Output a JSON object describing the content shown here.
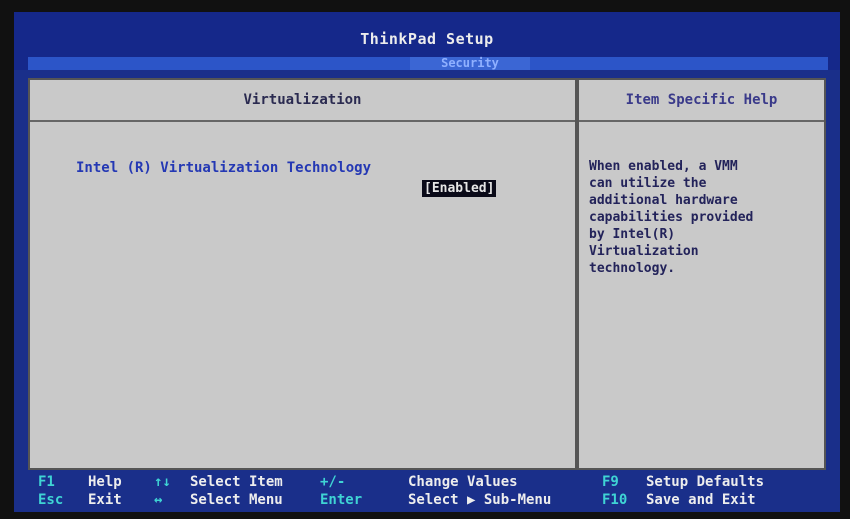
{
  "title": "ThinkPad Setup",
  "active_tab": "Security",
  "main_panel": {
    "header": "Virtualization",
    "items": [
      {
        "label": "Intel (R) Virtualization Technology",
        "value": "[Enabled]"
      }
    ]
  },
  "help_panel": {
    "header": "Item Specific Help",
    "text": "When enabled, a VMM\ncan utilize the\nadditional hardware\ncapabilities provided\nby Intel(R)\nVirtualization\ntechnology."
  },
  "footer": {
    "row1": [
      {
        "key": "F1",
        "desc": "Help"
      },
      {
        "key": "↑↓",
        "desc": "Select Item"
      },
      {
        "key": "+/-",
        "desc": "Change Values"
      },
      {
        "key": "F9",
        "desc": "Setup Defaults"
      }
    ],
    "row2": [
      {
        "key": "Esc",
        "desc": "Exit"
      },
      {
        "key": "↔",
        "desc": "Select Menu"
      },
      {
        "key": "Enter",
        "desc": "Select ▶ Sub-Menu"
      },
      {
        "key": "F10",
        "desc": "Save and Exit"
      }
    ]
  },
  "colors": {
    "background": "#1a2f8a",
    "panel": "#c9c9c9",
    "key_text": "#3fd4d4",
    "item_text": "#2438b4"
  }
}
